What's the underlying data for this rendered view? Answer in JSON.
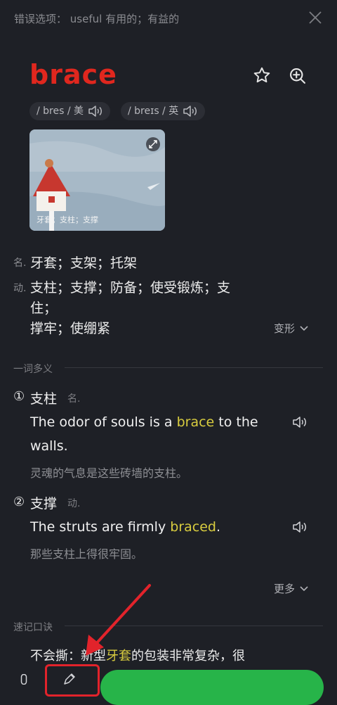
{
  "top": {
    "wrong_label": "错误选项：",
    "wrong_text": "useful 有用的；有益的"
  },
  "word": "brace",
  "pron": {
    "us": "/ bres / 美",
    "uk": "/ breɪs / 英"
  },
  "image": {
    "caption": "牙套；支柱；支撑"
  },
  "defs": [
    {
      "pos": "名.",
      "text": "牙套；支架；托架"
    },
    {
      "pos": "动.",
      "text_line1": "支柱；支撑；防备；使受锻炼；支",
      "text_line2": "住；",
      "text_line3": "撑牢；使绷紧"
    }
  ],
  "variant_label": "变形",
  "multi_label": "一词多义",
  "senses": [
    {
      "num": "①",
      "word": "支柱",
      "pos": "名.",
      "ex_pre": "The odor of souls is a ",
      "ex_hl": "brace",
      "ex_post": " to the",
      "ex_line2": "walls.",
      "trans": "灵魂的气息是这些砖墙的支柱。"
    },
    {
      "num": "②",
      "word": "支撑",
      "pos": "动.",
      "ex_pre": "The struts are firmly ",
      "ex_hl": "braced",
      "ex_post": ".",
      "trans": "那些支柱上得很牢固。"
    }
  ],
  "more_label": "更多",
  "mnemonic_label": "速记口诀",
  "mnemonic": {
    "pre": "不会撕：新型",
    "hl": "牙套",
    "post": "的包装非常复杂，很"
  },
  "colors": {
    "accent_red": "#e0271e",
    "highlight": "#d8cc3f",
    "green": "#27b449",
    "annotation": "#e2232b"
  },
  "icons": [
    "close-icon",
    "star-icon",
    "zoom-in-icon",
    "speaker-icon",
    "expand-icon",
    "chevron-down-icon",
    "mic-icon",
    "edit-icon"
  ]
}
